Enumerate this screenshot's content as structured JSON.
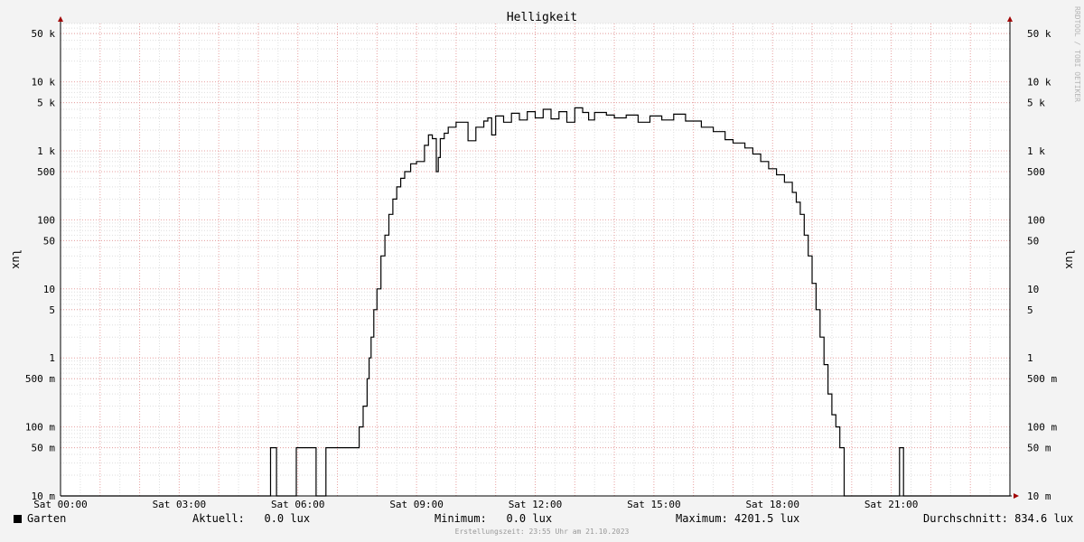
{
  "chart_data": {
    "type": "line",
    "title": "Helligkeit",
    "ylabel": "lux",
    "yscale": "log",
    "ylim": [
      0.01,
      70000
    ],
    "xlim": [
      0,
      24
    ],
    "watermark": "RRDTOOL / TOBI OETIKER",
    "x_ticks": [
      {
        "h": 0,
        "label": "Sat 00:00"
      },
      {
        "h": 3,
        "label": "Sat 03:00"
      },
      {
        "h": 6,
        "label": "Sat 06:00"
      },
      {
        "h": 9,
        "label": "Sat 09:00"
      },
      {
        "h": 12,
        "label": "Sat 12:00"
      },
      {
        "h": 15,
        "label": "Sat 15:00"
      },
      {
        "h": 18,
        "label": "Sat 18:00"
      },
      {
        "h": 21,
        "label": "Sat 21:00"
      }
    ],
    "y_ticks": [
      {
        "v": 0.01,
        "label": "10 m"
      },
      {
        "v": 0.05,
        "label": "50 m"
      },
      {
        "v": 0.1,
        "label": "100 m"
      },
      {
        "v": 0.5,
        "label": "500 m"
      },
      {
        "v": 1,
        "label": "1"
      },
      {
        "v": 5,
        "label": "5"
      },
      {
        "v": 10,
        "label": "10"
      },
      {
        "v": 50,
        "label": "50"
      },
      {
        "v": 100,
        "label": "100"
      },
      {
        "v": 500,
        "label": "500"
      },
      {
        "v": 1000,
        "label": "1 k"
      },
      {
        "v": 5000,
        "label": "5 k"
      },
      {
        "v": 10000,
        "label": "10 k"
      },
      {
        "v": 50000,
        "label": "50 k"
      }
    ],
    "series": [
      {
        "name": "Garten",
        "color": "#000000",
        "x": [
          0,
          5.3,
          5.31,
          5.45,
          5.46,
          5.95,
          5.96,
          6.45,
          6.46,
          6.7,
          6.71,
          7.5,
          7.55,
          7.65,
          7.75,
          7.8,
          7.85,
          7.92,
          8.0,
          8.1,
          8.2,
          8.3,
          8.4,
          8.5,
          8.6,
          8.7,
          8.85,
          9.0,
          9.2,
          9.3,
          9.4,
          9.5,
          9.55,
          9.6,
          9.7,
          9.8,
          10.0,
          10.3,
          10.5,
          10.7,
          10.8,
          10.9,
          11.0,
          11.2,
          11.4,
          11.6,
          11.8,
          12.0,
          12.2,
          12.4,
          12.6,
          12.8,
          13.0,
          13.2,
          13.35,
          13.5,
          13.8,
          14.0,
          14.3,
          14.6,
          14.9,
          15.2,
          15.5,
          15.8,
          16.2,
          16.5,
          16.8,
          17.0,
          17.3,
          17.5,
          17.7,
          17.9,
          18.1,
          18.3,
          18.5,
          18.6,
          18.7,
          18.8,
          18.9,
          19.0,
          19.1,
          19.2,
          19.3,
          19.4,
          19.5,
          19.6,
          19.7,
          19.8,
          19.81,
          21.2,
          21.21,
          21.3,
          21.31,
          24
        ],
        "values": [
          0.01,
          0.01,
          0.05,
          0.05,
          0.01,
          0.01,
          0.05,
          0.05,
          0.01,
          0.01,
          0.05,
          0.05,
          0.1,
          0.2,
          0.5,
          1,
          2,
          5,
          10,
          30,
          60,
          120,
          200,
          300,
          400,
          500,
          650,
          700,
          1200,
          1700,
          1500,
          500,
          800,
          1500,
          1800,
          2200,
          2600,
          1400,
          2200,
          2700,
          3000,
          1700,
          3200,
          2600,
          3500,
          2800,
          3700,
          3000,
          4000,
          2900,
          3700,
          2600,
          4200,
          3600,
          2800,
          3600,
          3300,
          3000,
          3300,
          2600,
          3200,
          2800,
          3400,
          2700,
          2200,
          1900,
          1450,
          1300,
          1100,
          900,
          700,
          550,
          450,
          350,
          250,
          180,
          120,
          60,
          30,
          12,
          5,
          2,
          0.8,
          0.3,
          0.15,
          0.1,
          0.05,
          0.05,
          0.01,
          0.01,
          0.05,
          0.05,
          0.01,
          0.01
        ]
      }
    ]
  },
  "legend": {
    "series_name": "Garten",
    "aktuell": "Aktuell:   0.0 lux",
    "minimum": "Minimum:   0.0 lux",
    "maximum": "Maximum: 4201.5 lux",
    "durchschnitt": "Durchschnitt: 834.6 lux"
  },
  "footer": "Erstellungszeit: 23:55 Uhr am 21.10.2023"
}
